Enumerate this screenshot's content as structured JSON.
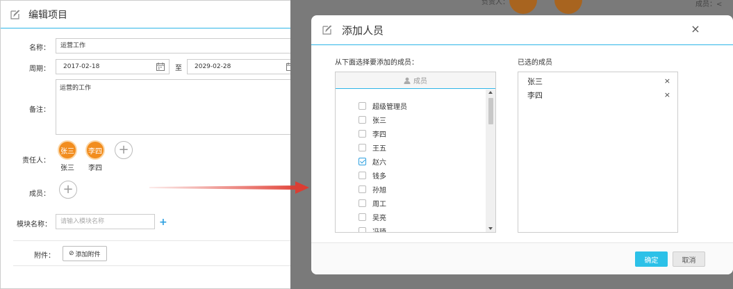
{
  "left": {
    "title": "编辑项目",
    "name_label": "名称：",
    "name_value": "运营工作",
    "period_label": "周期：",
    "start_date": "2017-02-18",
    "to_label": "至",
    "end_date": "2029-02-28",
    "note_label": "备注：",
    "note_value": "运营的工作",
    "owner_label": "责任人：",
    "owners": [
      {
        "avatar": "张三",
        "name": "张三"
      },
      {
        "avatar": "李四",
        "name": "李四"
      }
    ],
    "members_label": "成员：",
    "module_label": "模块名称：",
    "module_placeholder": "请输入模块名称",
    "attach_label": "附件：",
    "attach_button": "添加附件",
    "add_symbol": "+",
    "clip_symbol": "⊘"
  },
  "backdrop": {
    "owner_text": "负责人：",
    "member_text": "成员：<"
  },
  "modal": {
    "title": "添加人员",
    "close": "×",
    "select_label": "从下面选择要添加的成员：",
    "selected_label": "已选的成员",
    "member_header": "成员",
    "members": [
      {
        "name": "超级管理员",
        "checked": false
      },
      {
        "name": "张三",
        "checked": false
      },
      {
        "name": "李四",
        "checked": false
      },
      {
        "name": "王五",
        "checked": false
      },
      {
        "name": "赵六",
        "checked": true
      },
      {
        "name": "钱多",
        "checked": false
      },
      {
        "name": "孙旭",
        "checked": false
      },
      {
        "name": "周工",
        "checked": false
      },
      {
        "name": "吴亮",
        "checked": false
      },
      {
        "name": "冯琦",
        "checked": false
      }
    ],
    "selected": [
      {
        "name": "张三",
        "remove": "×"
      },
      {
        "name": "李四",
        "remove": "×"
      }
    ],
    "ok_button": "确定",
    "cancel_button": "取消"
  },
  "colors": {
    "accent": "#2cb5e8",
    "avatar": "#f28d1e",
    "arrow": "#e03a2f"
  }
}
